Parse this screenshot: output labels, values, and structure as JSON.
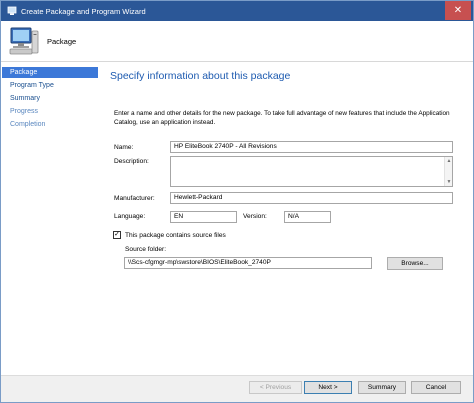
{
  "window": {
    "title": "Create Package and Program Wizard",
    "close_glyph": "✕"
  },
  "header": {
    "title": "Package",
    "icon": "computer-package-icon"
  },
  "sidebar": {
    "items": [
      {
        "label": "Package",
        "state": "active"
      },
      {
        "label": "Program Type",
        "state": "normal"
      },
      {
        "label": "Summary",
        "state": "normal"
      },
      {
        "label": "Progress",
        "state": "muted"
      },
      {
        "label": "Completion",
        "state": "muted"
      }
    ]
  },
  "main": {
    "page_title": "Specify information about this package",
    "instructions": "Enter a name and other details for the new package. To take full advantage of new features that include the Application Catalog, use an application instead.",
    "name_label": "Name:",
    "name_value": "HP EliteBook 2740P - All Revisions",
    "description_label": "Description:",
    "description_value": "",
    "manufacturer_label": "Manufacturer:",
    "manufacturer_value": "Hewlett-Packard",
    "language_label": "Language:",
    "language_value": "EN",
    "version_label": "Version:",
    "version_value": "N/A",
    "source_files_checkbox_label": "This package contains source files",
    "source_files_checked": true,
    "check_glyph": "✓",
    "source_folder_label": "Source folder:",
    "source_folder_value": "\\\\Scs-cfgmgr-mp\\swstore\\BIOS\\EliteBook_2740P",
    "browse_label": "Browse..."
  },
  "footer": {
    "previous_label": "< Previous",
    "next_label": "Next >",
    "summary_label": "Summary",
    "cancel_label": "Cancel"
  },
  "colors": {
    "titlebar": "#2b5797",
    "accent": "#1e5bb0",
    "nav_active": "#3c78d8",
    "close": "#c75050"
  }
}
